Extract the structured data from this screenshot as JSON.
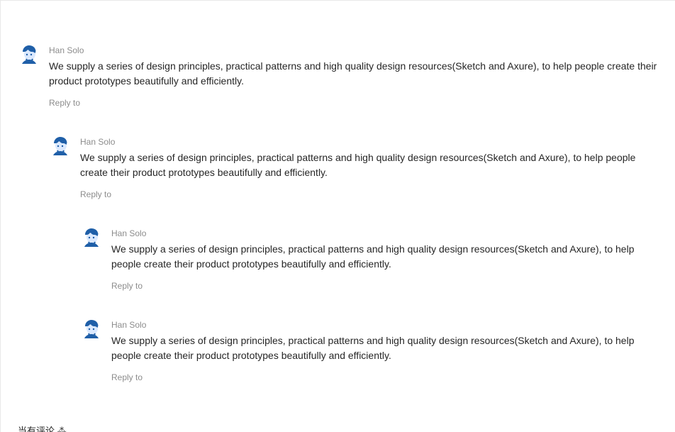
{
  "comments": [
    {
      "author": "Han Solo",
      "content": "We supply a series of design principles, practical patterns and high quality design resources(Sketch and Axure), to help people create their product prototypes beautifully and efficiently.",
      "action": "Reply to"
    },
    {
      "author": "Han Solo",
      "content": "We supply a series of design principles, practical patterns and high quality design resources(Sketch and Axure), to help people create their product prototypes beautifully and efficiently.",
      "action": "Reply to"
    },
    {
      "author": "Han Solo",
      "content": "We supply a series of design principles, practical patterns and high quality design resources(Sketch and Axure), to help people create their product prototypes beautifully and efficiently.",
      "action": "Reply to"
    },
    {
      "author": "Han Solo",
      "content": "We supply a series of design principles, practical patterns and high quality design resources(Sketch and Axure), to help people create their product prototypes beautifully and efficiently.",
      "action": "Reply to"
    }
  ],
  "footer": {
    "link_text": "当有评论 ⁂"
  },
  "colors": {
    "author": "#8c8c8c",
    "content": "#262626",
    "avatar_blue": "#1f5fa8"
  },
  "icons": {
    "avatar": "user-avatar-icon"
  }
}
